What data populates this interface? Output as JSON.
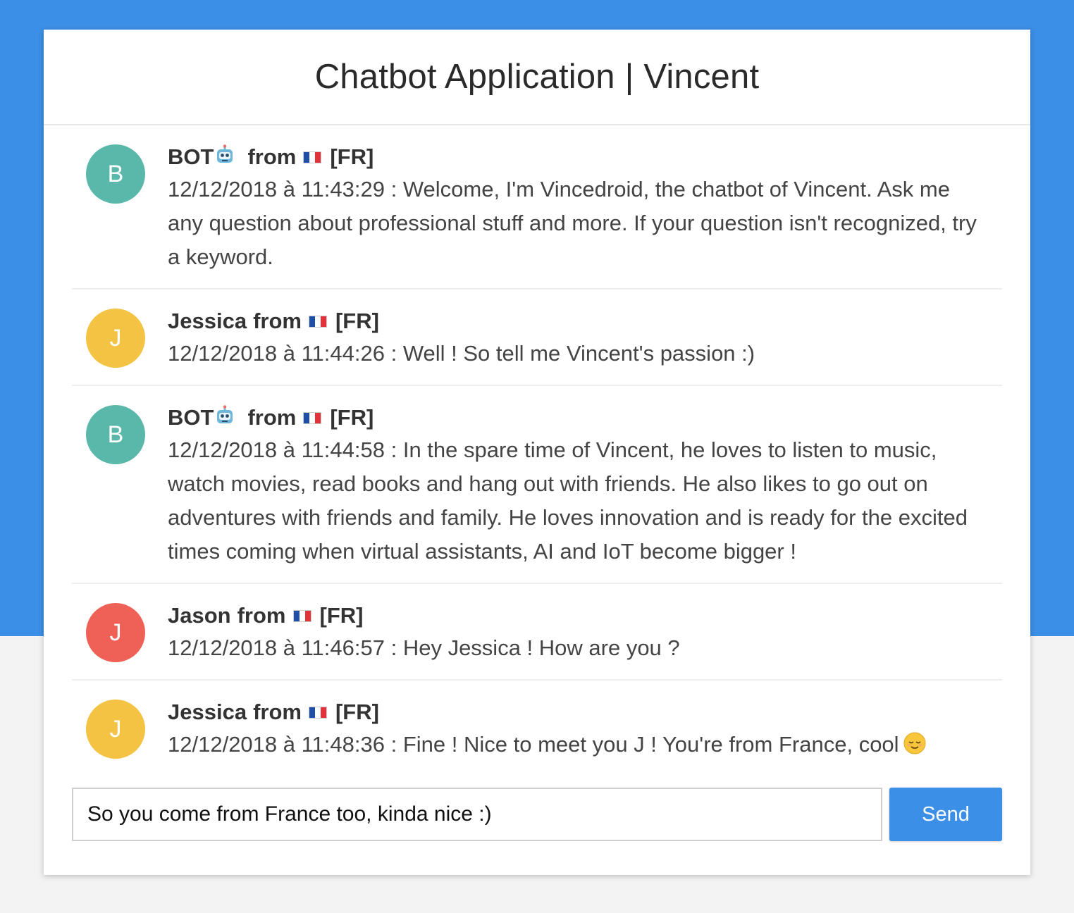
{
  "app": {
    "title": "Chatbot Application | Vincent"
  },
  "colors": {
    "accent": "#3c8fe6",
    "bot_avatar": "#5ab8ab",
    "jessica_avatar": "#f4c343",
    "jason_avatar": "#ef6157"
  },
  "messages": [
    {
      "avatar_letter": "B",
      "sender": "BOT",
      "sender_icon": "robot-icon",
      "from": "from",
      "flag_icon": "france-flag-icon",
      "country": "[FR]",
      "text": "12/12/2018 à 11:43:29 : Welcome, I'm Vincedroid, the chatbot of Vincent. Ask me any question about professional stuff and more. If your question isn't recognized, try a keyword."
    },
    {
      "avatar_letter": "J",
      "sender": "Jessica",
      "from": "from",
      "flag_icon": "france-flag-icon",
      "country": "[FR]",
      "text": "12/12/2018 à 11:44:26 : Well ! So tell me Vincent's passion :)"
    },
    {
      "avatar_letter": "B",
      "sender": "BOT",
      "sender_icon": "robot-icon",
      "from": "from",
      "flag_icon": "france-flag-icon",
      "country": "[FR]",
      "text": "12/12/2018 à 11:44:58 : In the spare time of Vincent, he loves to listen to music, watch movies, read books and hang out with friends. He also likes to go out on adventures with friends and family. He loves innovation and is ready for the excited times coming when virtual assistants, AI and IoT become bigger !"
    },
    {
      "avatar_letter": "J",
      "sender": "Jason",
      "from": "from",
      "flag_icon": "france-flag-icon",
      "country": "[FR]",
      "text": "12/12/2018 à 11:46:57 : Hey Jessica ! How are you ?"
    },
    {
      "avatar_letter": "J",
      "sender": "Jessica",
      "from": "from",
      "flag_icon": "france-flag-icon",
      "country": "[FR]",
      "text": "12/12/2018 à 11:48:36 : Fine ! Nice to meet you J ! You're from France, cool",
      "trailing_icon": "relieved-face-emoji-icon"
    }
  ],
  "composer": {
    "input_value": "So you come from France too, kinda nice :)",
    "send_label": "Send"
  }
}
